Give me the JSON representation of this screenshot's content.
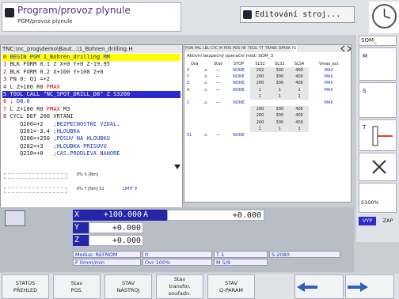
{
  "header": {
    "left_mode_title": "Program/provoz plynule",
    "left_mode_sub": "PGM/provoz plynule",
    "right_mode_title": "Editování stroj..."
  },
  "program": {
    "path": "TNC:\\nc_prog\\demo\\Baut...\\1_Bohren_drilling.H",
    "lines": [
      {
        "n": "0",
        "parts": [
          {
            "t": "BEGIN PGM ",
            "c": "kw"
          },
          {
            "t": "1_Bohren_drilling",
            "c": ""
          },
          {
            "t": " MM",
            "c": "kw"
          }
        ],
        "hl": false,
        "active": true
      },
      {
        "n": "1",
        "parts": [
          {
            "t": "BLK FORM 0.1 Z X+0 Y+0 Z-19.95",
            "c": ""
          }
        ]
      },
      {
        "n": "2",
        "parts": [
          {
            "t": "BLK FORM 0.2 X+100 Y+100 Z+0",
            "c": ""
          }
        ]
      },
      {
        "n": "3",
        "parts": [
          {
            "t": "FN 0: Q1 =+2",
            "c": ""
          }
        ]
      },
      {
        "n": "4",
        "parts": [
          {
            "t": "L Z+100 R0 ",
            "c": ""
          },
          {
            "t": "FMAX",
            "c": "red"
          }
        ]
      },
      {
        "n": "5",
        "parts": [
          {
            "t": "TOOL CALL \"NC_SPOT_DRILL_D8\" Z S3200",
            "c": ""
          }
        ],
        "hl": true
      },
      {
        "n": "6",
        "parts": [
          {
            "t": "; D8.0",
            "c": "cm"
          }
        ]
      },
      {
        "n": "7",
        "parts": [
          {
            "t": "L Z+100 R0 ",
            "c": ""
          },
          {
            "t": "FMAX",
            "c": "red"
          },
          {
            "t": " M3",
            "c": ""
          }
        ]
      },
      {
        "n": "8",
        "parts": [
          {
            "t": "CYCL DEF 200 VRTANI",
            "c": ""
          }
        ]
      },
      {
        "n": "",
        "parts": [
          {
            "t": "  Q200=+2   ",
            "c": ""
          },
          {
            "t": ";BEZPECNOSTNI VZDAL.",
            "c": "cm"
          }
        ]
      },
      {
        "n": "",
        "parts": [
          {
            "t": "  Q201=-3.4 ",
            "c": ""
          },
          {
            "t": ";HLOUBKA",
            "c": "cm"
          }
        ]
      },
      {
        "n": "",
        "parts": [
          {
            "t": "  Q206=+250 ",
            "c": ""
          },
          {
            "t": ";POSUV NA HLOUBKU",
            "c": "cm"
          }
        ]
      },
      {
        "n": "",
        "parts": [
          {
            "t": "  Q202=+3   ",
            "c": ""
          },
          {
            "t": ";HLOUBKA PRISUVU",
            "c": "cm"
          }
        ]
      },
      {
        "n": "",
        "parts": [
          {
            "t": "  Q210=+0   ",
            "c": ""
          },
          {
            "t": ";CAS.PRODLEVA NAHORE",
            "c": "cm"
          }
        ]
      }
    ],
    "bar1": "0% X [Nm]",
    "bar2": "0% Y [Nm]  S1",
    "limit": "LIMIT 9"
  },
  "status": {
    "tabs": [
      "PGM",
      "PAL",
      "LBL",
      "CYC",
      "M",
      "POS",
      "POS HR",
      "TOOL",
      "TT",
      "TRANS",
      "OPARA",
      "FS"
    ],
    "active_tab": "FS",
    "mode_label": "Aktivní bezpečný operační mód: SOM_3",
    "headers": [
      "Osa",
      "",
      "Stav",
      "STOP",
      "SLS2",
      "SLS3",
      "SLS4",
      "Vmax_act"
    ],
    "rows": [
      [
        "X",
        "⚠",
        "---",
        "NONE",
        "202",
        "300",
        "400",
        "MAX"
      ],
      [
        "Y",
        "⚠",
        "---",
        "NONE",
        "200",
        "300",
        "400",
        "MAX"
      ],
      [
        "Z",
        "⚠",
        "---",
        "NONE",
        "200",
        "300",
        "400",
        "MAX"
      ],
      [
        "A",
        "⚠",
        "---",
        "NONE",
        "1",
        "1",
        "1",
        "MAX"
      ],
      [
        "",
        "",
        "",
        "",
        "1",
        "1",
        "1",
        ""
      ],
      [
        "C",
        "⚠",
        "---",
        "NONE",
        "",
        "",
        "",
        "MAX"
      ],
      [
        "",
        "",
        "",
        "",
        "200",
        "300",
        "400",
        ""
      ],
      [
        "",
        "",
        "",
        "",
        "200",
        "300",
        "400",
        ""
      ],
      [
        "",
        "",
        "",
        "",
        "200",
        "300",
        "400",
        ""
      ],
      [
        "",
        "",
        "",
        "",
        "1",
        "1",
        "1",
        ""
      ],
      [
        "S1",
        "⚠",
        "---",
        "NONE",
        "",
        "",
        "",
        ""
      ]
    ]
  },
  "right": {
    "som": "SOM_",
    "m": "M",
    "s": "S",
    "t": "T",
    "ovr": "S100%",
    "vyp": "VYP",
    "zap": "ZAP"
  },
  "positions": {
    "axes": [
      {
        "n": "X",
        "v": "+100.000"
      },
      {
        "n": "Y",
        "v": "+0.000"
      },
      {
        "n": "Z",
        "v": "+0.000"
      }
    ],
    "a_axis": "A",
    "a_val": "+0.000",
    "modus": "Modus: REFNOM",
    "f_val": "F  0mm/min",
    "ovr": "Ovr 100%",
    "t": "T 1",
    "m": "M 5/9",
    "s": "S 2080",
    "s_lbl": "S",
    "zero": "0"
  },
  "softkeys": [
    {
      "l1": "STATUS",
      "l2": "PŘEHLED"
    },
    {
      "l1": "Stav",
      "l2": "POS."
    },
    {
      "l1": "STAV",
      "l2": "NÁSTROJ"
    },
    {
      "l1": "Stav",
      "l2": "transfor.",
      "l3": "souřadn."
    },
    {
      "l1": "STAV",
      "l2": "Q-PARAM"
    }
  ]
}
